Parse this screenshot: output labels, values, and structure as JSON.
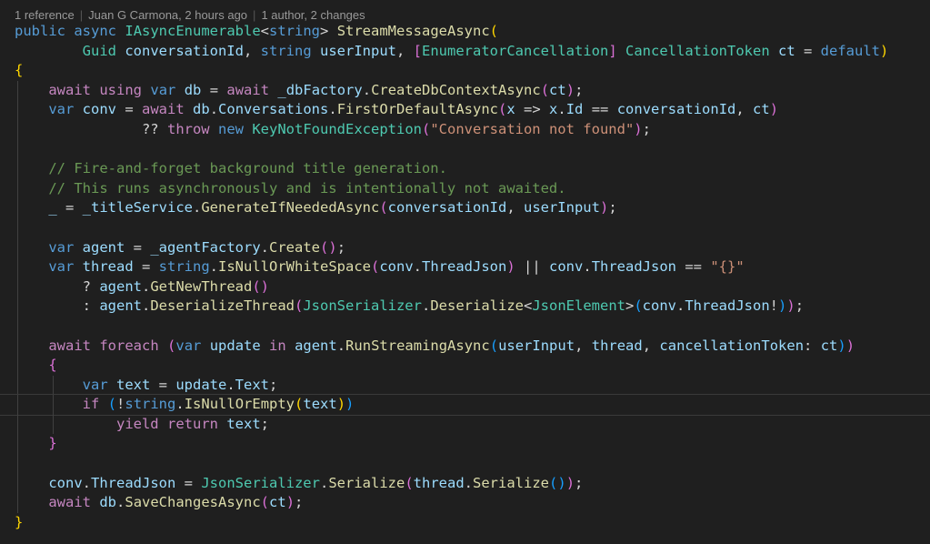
{
  "codelens": {
    "references": "1 reference",
    "author_time": "Juan G Carmona, 2 hours ago",
    "authors_changes": "1 author, 2 changes"
  },
  "colors": {
    "background": "#1f1f1f",
    "keyword": "#569cd6",
    "control": "#c586c0",
    "type": "#4ec9b0",
    "function": "#dcdcaa",
    "variable": "#9cdcfe",
    "string": "#ce9178",
    "comment": "#6a9955",
    "bracket_1": "#ffd700",
    "bracket_2": "#da70d6",
    "bracket_3": "#179fff"
  },
  "current_line": 19,
  "lines": [
    {
      "indent": 0,
      "tokens": [
        [
          "kw",
          "public"
        ],
        [
          "op",
          " "
        ],
        [
          "kw",
          "async"
        ],
        [
          "op",
          " "
        ],
        [
          "ty",
          "IAsyncEnumerable"
        ],
        [
          "op",
          "<"
        ],
        [
          "kw",
          "string"
        ],
        [
          "op",
          "> "
        ],
        [
          "fn",
          "StreamMessageAsync"
        ],
        [
          "b1",
          "("
        ]
      ]
    },
    {
      "indent": 0,
      "tokens": [
        [
          "op",
          "        "
        ],
        [
          "ty",
          "Guid"
        ],
        [
          "op",
          " "
        ],
        [
          "vr",
          "conversationId"
        ],
        [
          "op",
          ", "
        ],
        [
          "kw",
          "string"
        ],
        [
          "op",
          " "
        ],
        [
          "vr",
          "userInput"
        ],
        [
          "op",
          ", "
        ],
        [
          "b2",
          "["
        ],
        [
          "ty",
          "EnumeratorCancellation"
        ],
        [
          "b2",
          "]"
        ],
        [
          "op",
          " "
        ],
        [
          "ty",
          "CancellationToken"
        ],
        [
          "op",
          " "
        ],
        [
          "vr",
          "ct"
        ],
        [
          "op",
          " = "
        ],
        [
          "kw",
          "default"
        ],
        [
          "b1",
          ")"
        ]
      ]
    },
    {
      "indent": 0,
      "tokens": [
        [
          "b1",
          "{"
        ]
      ]
    },
    {
      "indent": 1,
      "tokens": [
        [
          "op",
          "    "
        ],
        [
          "ctl",
          "await"
        ],
        [
          "op",
          " "
        ],
        [
          "ctl",
          "using"
        ],
        [
          "op",
          " "
        ],
        [
          "kw",
          "var"
        ],
        [
          "op",
          " "
        ],
        [
          "vr",
          "db"
        ],
        [
          "op",
          " = "
        ],
        [
          "ctl",
          "await"
        ],
        [
          "op",
          " "
        ],
        [
          "vr",
          "_dbFactory"
        ],
        [
          "op",
          "."
        ],
        [
          "fn",
          "CreateDbContextAsync"
        ],
        [
          "b2",
          "("
        ],
        [
          "vr",
          "ct"
        ],
        [
          "b2",
          ")"
        ],
        [
          "op",
          ";"
        ]
      ]
    },
    {
      "indent": 1,
      "tokens": [
        [
          "op",
          "    "
        ],
        [
          "kw",
          "var"
        ],
        [
          "op",
          " "
        ],
        [
          "vr",
          "conv"
        ],
        [
          "op",
          " = "
        ],
        [
          "ctl",
          "await"
        ],
        [
          "op",
          " "
        ],
        [
          "vr",
          "db"
        ],
        [
          "op",
          "."
        ],
        [
          "vr",
          "Conversations"
        ],
        [
          "op",
          "."
        ],
        [
          "fn",
          "FirstOrDefaultAsync"
        ],
        [
          "b2",
          "("
        ],
        [
          "vr",
          "x"
        ],
        [
          "op",
          " => "
        ],
        [
          "vr",
          "x"
        ],
        [
          "op",
          "."
        ],
        [
          "vr",
          "Id"
        ],
        [
          "op",
          " == "
        ],
        [
          "vr",
          "conversationId"
        ],
        [
          "op",
          ", "
        ],
        [
          "vr",
          "ct"
        ],
        [
          "b2",
          ")"
        ]
      ]
    },
    {
      "indent": 1,
      "tokens": [
        [
          "op",
          "               ?? "
        ],
        [
          "ctl",
          "throw"
        ],
        [
          "op",
          " "
        ],
        [
          "kw",
          "new"
        ],
        [
          "op",
          " "
        ],
        [
          "ty",
          "KeyNotFoundException"
        ],
        [
          "b2",
          "("
        ],
        [
          "str",
          "\"Conversation not found\""
        ],
        [
          "b2",
          ")"
        ],
        [
          "op",
          ";"
        ]
      ]
    },
    {
      "indent": 1,
      "tokens": [
        [
          "op",
          ""
        ]
      ]
    },
    {
      "indent": 1,
      "tokens": [
        [
          "op",
          "    "
        ],
        [
          "cm",
          "// Fire-and-forget background title generation."
        ]
      ]
    },
    {
      "indent": 1,
      "tokens": [
        [
          "op",
          "    "
        ],
        [
          "cm",
          "// This runs asynchronously and is intentionally not awaited."
        ]
      ]
    },
    {
      "indent": 1,
      "tokens": [
        [
          "op",
          "    "
        ],
        [
          "vr",
          "_"
        ],
        [
          "op",
          " = "
        ],
        [
          "vr",
          "_titleService"
        ],
        [
          "op",
          "."
        ],
        [
          "fn",
          "GenerateIfNeededAsync"
        ],
        [
          "b2",
          "("
        ],
        [
          "vr",
          "conversationId"
        ],
        [
          "op",
          ", "
        ],
        [
          "vr",
          "userInput"
        ],
        [
          "b2",
          ")"
        ],
        [
          "op",
          ";"
        ]
      ]
    },
    {
      "indent": 1,
      "tokens": [
        [
          "op",
          ""
        ]
      ]
    },
    {
      "indent": 1,
      "tokens": [
        [
          "op",
          "    "
        ],
        [
          "kw",
          "var"
        ],
        [
          "op",
          " "
        ],
        [
          "vr",
          "agent"
        ],
        [
          "op",
          " = "
        ],
        [
          "vr",
          "_agentFactory"
        ],
        [
          "op",
          "."
        ],
        [
          "fn",
          "Create"
        ],
        [
          "b2",
          "("
        ],
        [
          "b2",
          ")"
        ],
        [
          "op",
          ";"
        ]
      ]
    },
    {
      "indent": 1,
      "tokens": [
        [
          "op",
          "    "
        ],
        [
          "kw",
          "var"
        ],
        [
          "op",
          " "
        ],
        [
          "vr",
          "thread"
        ],
        [
          "op",
          " = "
        ],
        [
          "kw",
          "string"
        ],
        [
          "op",
          "."
        ],
        [
          "fn",
          "IsNullOrWhiteSpace"
        ],
        [
          "b2",
          "("
        ],
        [
          "vr",
          "conv"
        ],
        [
          "op",
          "."
        ],
        [
          "vr",
          "ThreadJson"
        ],
        [
          "b2",
          ")"
        ],
        [
          "op",
          " || "
        ],
        [
          "vr",
          "conv"
        ],
        [
          "op",
          "."
        ],
        [
          "vr",
          "ThreadJson"
        ],
        [
          "op",
          " == "
        ],
        [
          "str",
          "\"{}\""
        ]
      ]
    },
    {
      "indent": 1,
      "tokens": [
        [
          "op",
          "        ? "
        ],
        [
          "vr",
          "agent"
        ],
        [
          "op",
          "."
        ],
        [
          "fn",
          "GetNewThread"
        ],
        [
          "b2",
          "("
        ],
        [
          "b2",
          ")"
        ]
      ]
    },
    {
      "indent": 1,
      "tokens": [
        [
          "op",
          "        : "
        ],
        [
          "vr",
          "agent"
        ],
        [
          "op",
          "."
        ],
        [
          "fn",
          "DeserializeThread"
        ],
        [
          "b2",
          "("
        ],
        [
          "ty",
          "JsonSerializer"
        ],
        [
          "op",
          "."
        ],
        [
          "fn",
          "Deserialize"
        ],
        [
          "op",
          "<"
        ],
        [
          "ty",
          "JsonElement"
        ],
        [
          "op",
          ">"
        ],
        [
          "b3",
          "("
        ],
        [
          "vr",
          "conv"
        ],
        [
          "op",
          "."
        ],
        [
          "vr",
          "ThreadJson"
        ],
        [
          "op",
          "!"
        ],
        [
          "b3",
          ")"
        ],
        [
          "b2",
          ")"
        ],
        [
          "op",
          ";"
        ]
      ]
    },
    {
      "indent": 1,
      "tokens": [
        [
          "op",
          ""
        ]
      ]
    },
    {
      "indent": 1,
      "tokens": [
        [
          "op",
          "    "
        ],
        [
          "ctl",
          "await"
        ],
        [
          "op",
          " "
        ],
        [
          "ctl",
          "foreach"
        ],
        [
          "op",
          " "
        ],
        [
          "b2",
          "("
        ],
        [
          "kw",
          "var"
        ],
        [
          "op",
          " "
        ],
        [
          "vr",
          "update"
        ],
        [
          "op",
          " "
        ],
        [
          "ctl",
          "in"
        ],
        [
          "op",
          " "
        ],
        [
          "vr",
          "agent"
        ],
        [
          "op",
          "."
        ],
        [
          "fn",
          "RunStreamingAsync"
        ],
        [
          "b3",
          "("
        ],
        [
          "vr",
          "userInput"
        ],
        [
          "op",
          ", "
        ],
        [
          "vr",
          "thread"
        ],
        [
          "op",
          ", "
        ],
        [
          "vr",
          "cancellationToken"
        ],
        [
          "op",
          ": "
        ],
        [
          "vr",
          "ct"
        ],
        [
          "b3",
          ")"
        ],
        [
          "b2",
          ")"
        ]
      ]
    },
    {
      "indent": 1,
      "tokens": [
        [
          "op",
          "    "
        ],
        [
          "b2",
          "{"
        ]
      ]
    },
    {
      "indent": 2,
      "tokens": [
        [
          "op",
          "        "
        ],
        [
          "kw",
          "var"
        ],
        [
          "op",
          " "
        ],
        [
          "vr",
          "text"
        ],
        [
          "op",
          " = "
        ],
        [
          "vr",
          "update"
        ],
        [
          "op",
          "."
        ],
        [
          "vr",
          "Text"
        ],
        [
          "op",
          ";"
        ]
      ]
    },
    {
      "indent": 2,
      "tokens": [
        [
          "op",
          "        "
        ],
        [
          "ctl",
          "if"
        ],
        [
          "op",
          " "
        ],
        [
          "b3",
          "("
        ],
        [
          "op",
          "!"
        ],
        [
          "kw",
          "string"
        ],
        [
          "op",
          "."
        ],
        [
          "fn",
          "IsNullOrEmpty"
        ],
        [
          "b1",
          "("
        ],
        [
          "vr",
          "text"
        ],
        [
          "b1",
          ")"
        ],
        [
          "b3",
          ")"
        ]
      ]
    },
    {
      "indent": 2,
      "tokens": [
        [
          "op",
          "            "
        ],
        [
          "ctl",
          "yield"
        ],
        [
          "op",
          " "
        ],
        [
          "ctl",
          "return"
        ],
        [
          "op",
          " "
        ],
        [
          "vr",
          "text"
        ],
        [
          "op",
          ";"
        ]
      ]
    },
    {
      "indent": 1,
      "tokens": [
        [
          "op",
          "    "
        ],
        [
          "b2",
          "}"
        ]
      ]
    },
    {
      "indent": 1,
      "tokens": [
        [
          "op",
          ""
        ]
      ]
    },
    {
      "indent": 1,
      "tokens": [
        [
          "op",
          "    "
        ],
        [
          "vr",
          "conv"
        ],
        [
          "op",
          "."
        ],
        [
          "vr",
          "ThreadJson"
        ],
        [
          "op",
          " = "
        ],
        [
          "ty",
          "JsonSerializer"
        ],
        [
          "op",
          "."
        ],
        [
          "fn",
          "Serialize"
        ],
        [
          "b2",
          "("
        ],
        [
          "vr",
          "thread"
        ],
        [
          "op",
          "."
        ],
        [
          "fn",
          "Serialize"
        ],
        [
          "b3",
          "("
        ],
        [
          "b3",
          ")"
        ],
        [
          "b2",
          ")"
        ],
        [
          "op",
          ";"
        ]
      ]
    },
    {
      "indent": 1,
      "tokens": [
        [
          "op",
          "    "
        ],
        [
          "ctl",
          "await"
        ],
        [
          "op",
          " "
        ],
        [
          "vr",
          "db"
        ],
        [
          "op",
          "."
        ],
        [
          "fn",
          "SaveChangesAsync"
        ],
        [
          "b2",
          "("
        ],
        [
          "vr",
          "ct"
        ],
        [
          "b2",
          ")"
        ],
        [
          "op",
          ";"
        ]
      ]
    },
    {
      "indent": 0,
      "tokens": [
        [
          "b1",
          "}"
        ]
      ]
    }
  ]
}
